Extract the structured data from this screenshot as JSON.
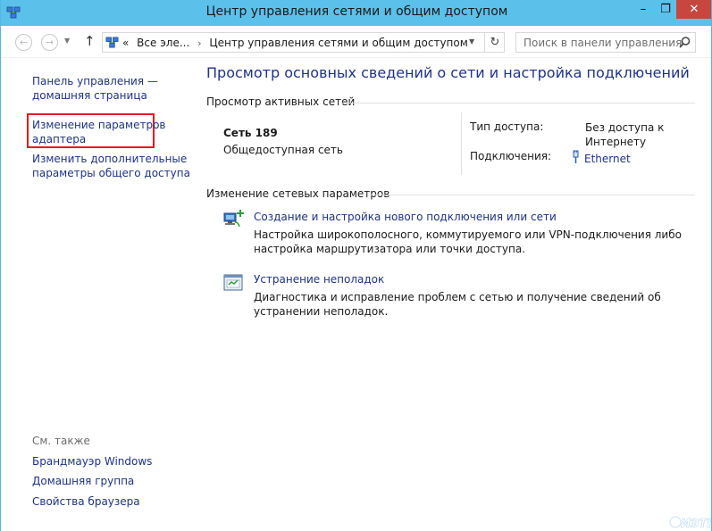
{
  "window": {
    "title": "Центр управления сетями и общим доступом",
    "min_glyph": "–",
    "max_glyph": "❐",
    "close_glyph": "✕"
  },
  "nav": {
    "back_glyph": "←",
    "forward_glyph": "→",
    "dropdown_glyph": "▼",
    "up_glyph": "↑",
    "breadcrumb": {
      "overflow": "«",
      "item1": "Все эле...",
      "separator": "›",
      "item2": "Центр управления сетями и общим доступом"
    },
    "refresh_glyph": "↻",
    "search_placeholder": "Поиск в панели управления"
  },
  "sidebar": {
    "home_link": "Панель управления — домашняя страница",
    "adapter_link": "Изменение параметров адаптера",
    "sharing_link": "Изменить дополнительные параметры общего доступа",
    "see_also_label": "См. также",
    "firewall_link": "Брандмауэр Windows",
    "homegroup_link": "Домашняя группа",
    "browser_link": "Свойства браузера"
  },
  "main": {
    "title": "Просмотр основных сведений о сети и настройка подключений",
    "active_networks_header": "Просмотр активных сетей",
    "network": {
      "name": "Сеть  189",
      "type": "Общедоступная сеть",
      "access_type_label": "Тип доступа:",
      "access_type_value": "Без доступа к Интернету",
      "connections_label": "Подключения:",
      "connections_value": "Ethernet"
    },
    "change_settings_header": "Изменение сетевых параметров",
    "tasks": [
      {
        "link": "Создание и настройка нового подключения или сети",
        "description": "Настройка широкополосного, коммутируемого или VPN-подключения либо настройка маршрутизатора или точки доступа."
      },
      {
        "link": "Устранение неполадок",
        "description": "Диагностика и исправление проблем с сетью и получение сведений об устранении неполадок."
      }
    ]
  },
  "colors": {
    "titlebar": "#5bc0ea",
    "link": "#1e3287",
    "highlight_box": "#e01b24",
    "close_button": "#c7463e"
  }
}
